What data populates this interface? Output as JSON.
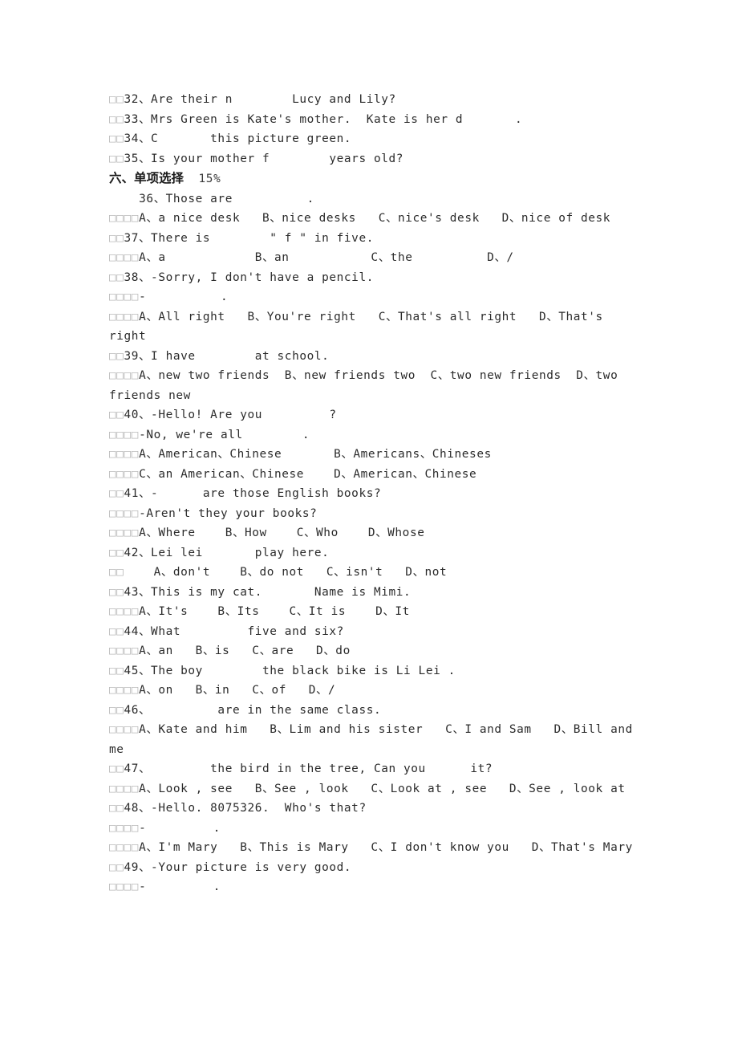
{
  "document": {
    "page_background": "#ffffff",
    "text_color": "#2b2b2b",
    "placeholder_color": "#b9b9b9",
    "box_glyph": "□",
    "enumeration_comma": "、"
  },
  "section_heading": {
    "label": "六、单项选择",
    "points": "15%"
  },
  "lines": [
    {
      "boxes": 2,
      "text": "32、Are their n        Lucy and Lily?"
    },
    {
      "boxes": 2,
      "text": "33、Mrs Green is Kate's mother.  Kate is her d       ."
    },
    {
      "boxes": 2,
      "text": "34、C       this picture green."
    },
    {
      "boxes": 2,
      "text": "35、Is your mother f        years old?"
    },
    {
      "boxes": 0,
      "text": "    36、Those are          ."
    },
    {
      "boxes": 4,
      "text": "A、a nice desk   B、nice desks   C、nice's desk   D、nice of desk"
    },
    {
      "boxes": 2,
      "text": "37、There is        \" f \" in five."
    },
    {
      "boxes": 4,
      "text": "A、a            B、an           C、the          D、/"
    },
    {
      "boxes": 2,
      "text": "38、-Sorry, I don't have a pencil."
    },
    {
      "boxes": 4,
      "text": "-          ."
    },
    {
      "boxes": 4,
      "text": "A、All right   B、You're right   C、That's all right   D、That's right"
    },
    {
      "boxes": 2,
      "text": "39、I have        at school."
    },
    {
      "boxes": 4,
      "text": "A、new two friends  B、new friends two  C、two new friends  D、two friends new"
    },
    {
      "boxes": 2,
      "text": "40、-Hello! Are you         ?"
    },
    {
      "boxes": 4,
      "text": "-No, we're all        ."
    },
    {
      "boxes": 4,
      "text": "A、American、Chinese       B、Americans、Chineses"
    },
    {
      "boxes": 4,
      "text": "C、an American、Chinese    D、American、Chinese"
    },
    {
      "boxes": 2,
      "text": "41、-      are those English books?"
    },
    {
      "boxes": 4,
      "text": "-Aren't they your books?"
    },
    {
      "boxes": 4,
      "text": "A、Where    B、How    C、Who    D、Whose"
    },
    {
      "boxes": 2,
      "text": "42、Lei lei       play here."
    },
    {
      "boxes": 2,
      "text": "    A、don't    B、do not   C、isn't   D、not"
    },
    {
      "boxes": 2,
      "text": "43、This is my cat.       Name is Mimi."
    },
    {
      "boxes": 4,
      "text": "A、It's    B、Its    C、It is    D、It"
    },
    {
      "boxes": 2,
      "text": "44、What         five and six?"
    },
    {
      "boxes": 4,
      "text": "A、an   B、is   C、are   D、do"
    },
    {
      "boxes": 2,
      "text": "45、The boy        the black bike is Li Lei ."
    },
    {
      "boxes": 4,
      "text": "A、on   B、in   C、of   D、/"
    },
    {
      "boxes": 2,
      "text": "46、         are in the same class."
    },
    {
      "boxes": 4,
      "text": "A、Kate and him   B、Lim and his sister   C、I and Sam   D、Bill and me"
    },
    {
      "boxes": 2,
      "text": "47、        the bird in the tree, Can you      it?"
    },
    {
      "boxes": 4,
      "text": "A、Look , see   B、See , look   C、Look at , see   D、See , look at"
    },
    {
      "boxes": 2,
      "text": "48、-Hello. 8075326.  Who's that?"
    },
    {
      "boxes": 4,
      "text": "-         ."
    },
    {
      "boxes": 4,
      "text": "A、I'm Mary   B、This is Mary   C、I don't know you   D、That's Mary"
    },
    {
      "boxes": 2,
      "text": "49、-Your picture is very good."
    },
    {
      "boxes": 4,
      "text": "-         ."
    }
  ],
  "heading_after_line_index": 3
}
